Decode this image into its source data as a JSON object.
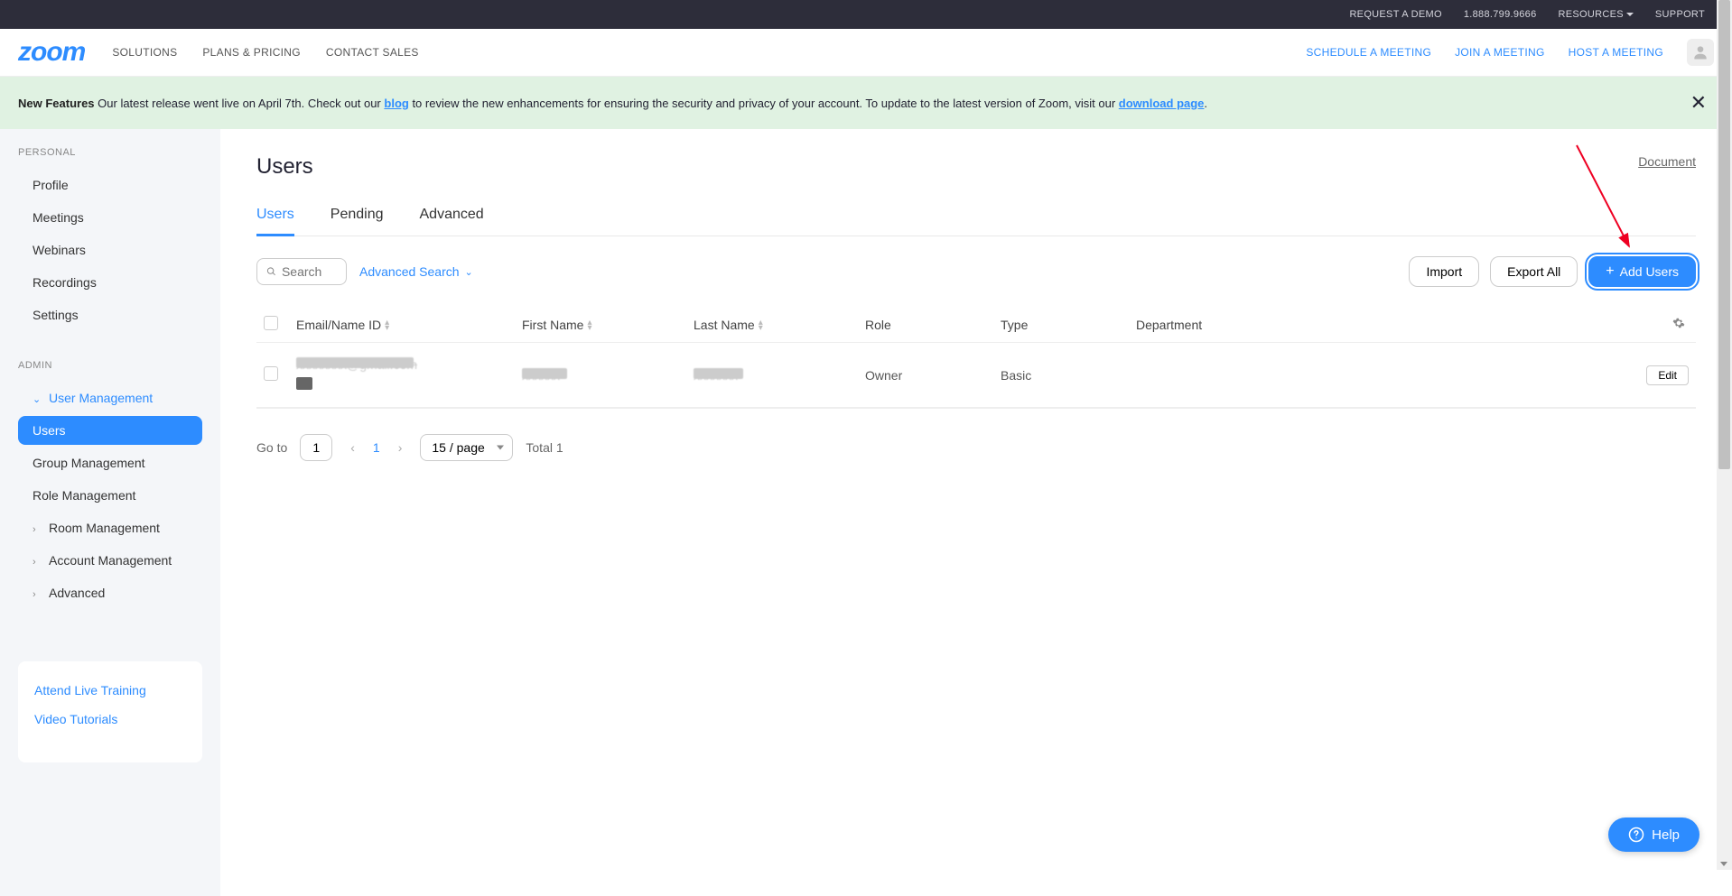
{
  "topbar": {
    "request_demo": "REQUEST A DEMO",
    "phone": "1.888.799.9666",
    "resources": "RESOURCES",
    "support": "SUPPORT"
  },
  "header": {
    "logo": "zoom",
    "solutions": "SOLUTIONS",
    "plans": "PLANS & PRICING",
    "contact": "CONTACT SALES",
    "schedule": "SCHEDULE A MEETING",
    "join": "JOIN A MEETING",
    "host": "HOST A MEETING"
  },
  "banner": {
    "bold": "New Features",
    "text1": " Our latest release went live on April 7th. Check out our ",
    "link1": "blog",
    "text2": " to review the new enhancements for ensuring the security and privacy of your account. To update to the latest version of Zoom, visit our ",
    "link2": "download page",
    "text3": "."
  },
  "sidebar": {
    "personal_label": "PERSONAL",
    "personal": [
      "Profile",
      "Meetings",
      "Webinars",
      "Recordings",
      "Settings"
    ],
    "admin_label": "ADMIN",
    "user_management": "User Management",
    "users": "Users",
    "group_management": "Group Management",
    "role_management": "Role Management",
    "room_management": "Room Management",
    "account_management": "Account Management",
    "advanced": "Advanced",
    "help": {
      "training": "Attend Live Training",
      "tutorials": "Video Tutorials"
    }
  },
  "main": {
    "title": "Users",
    "doc_link": "Document",
    "tabs": {
      "users": "Users",
      "pending": "Pending",
      "advanced": "Advanced"
    },
    "search_placeholder": "Search",
    "adv_search": "Advanced Search",
    "import": "Import",
    "export": "Export All",
    "add_users": "Add Users",
    "columns": {
      "email": "Email/Name ID",
      "first_name": "First Name",
      "last_name": "Last Name",
      "role": "Role",
      "type": "Type",
      "department": "Department"
    },
    "row": {
      "role": "Owner",
      "type": "Basic"
    },
    "edit": "Edit",
    "pagination": {
      "goto": "Go to",
      "page": "1",
      "current": "1",
      "per_page": "15 / page",
      "total": "Total 1"
    }
  },
  "help_btn": "Help"
}
